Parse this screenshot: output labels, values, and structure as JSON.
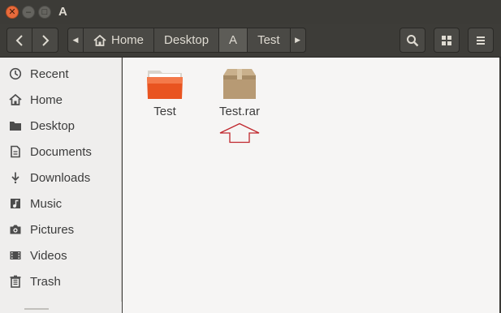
{
  "window": {
    "title": "A"
  },
  "pathbar": {
    "segments": [
      "Home",
      "Desktop",
      "A",
      "Test"
    ]
  },
  "sidebar": {
    "items": [
      {
        "label": "Recent",
        "icon": "clock-icon"
      },
      {
        "label": "Home",
        "icon": "home-icon"
      },
      {
        "label": "Desktop",
        "icon": "folder-icon"
      },
      {
        "label": "Documents",
        "icon": "document-icon"
      },
      {
        "label": "Downloads",
        "icon": "download-icon"
      },
      {
        "label": "Music",
        "icon": "music-icon"
      },
      {
        "label": "Pictures",
        "icon": "camera-icon"
      },
      {
        "label": "Videos",
        "icon": "video-icon"
      },
      {
        "label": "Trash",
        "icon": "trash-icon"
      }
    ]
  },
  "files": [
    {
      "name": "Test",
      "icon": "folder-icon"
    },
    {
      "name": "Test.rar",
      "icon": "archive-icon"
    }
  ],
  "colors": {
    "accent": "#e95420",
    "titlebar": "#3c3b37",
    "annotation": "#c0272d"
  }
}
